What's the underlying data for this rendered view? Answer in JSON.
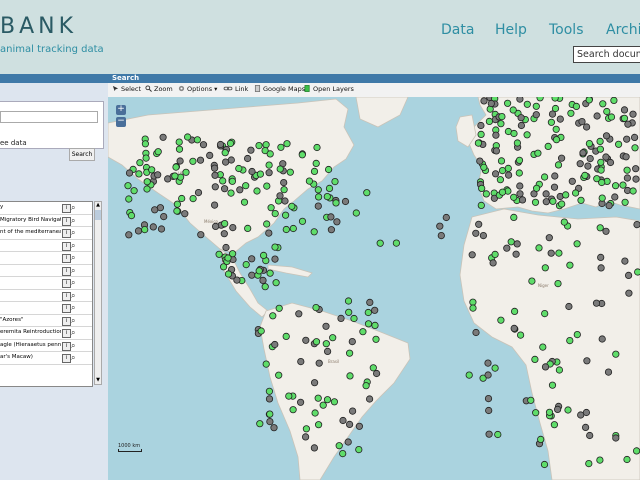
{
  "header": {
    "logo": "BANK",
    "tagline": "animal tracking data",
    "nav": [
      "Data",
      "Help",
      "Tools",
      "Archiv"
    ],
    "search_docs": "Search docume"
  },
  "search_bar": {
    "title": "Search"
  },
  "toolbar": {
    "items": [
      "Select",
      "Zoom",
      "Options",
      "Link",
      "Google Maps",
      "Open Layers"
    ]
  },
  "sidebar": {
    "panel_text": "ee data",
    "search_button": "Search",
    "list_items": [
      "y",
      "Migratory Bird Navigatio",
      "nt of the mediterranean g",
      "",
      "",
      "",
      "",
      "",
      "",
      "\"Azores\"",
      "eremita Reintroduction in",
      "agle (Hieraaetus pennat",
      "ar's Macaw)"
    ]
  },
  "map": {
    "zoom_in": "+",
    "zoom_out": "−",
    "scale_label": "1000 km",
    "colors": {
      "ocean": "#aad3df",
      "land": "#f2efe9",
      "green_marker": "#5fdd6a",
      "grey_marker": "#7a7a7a"
    }
  }
}
